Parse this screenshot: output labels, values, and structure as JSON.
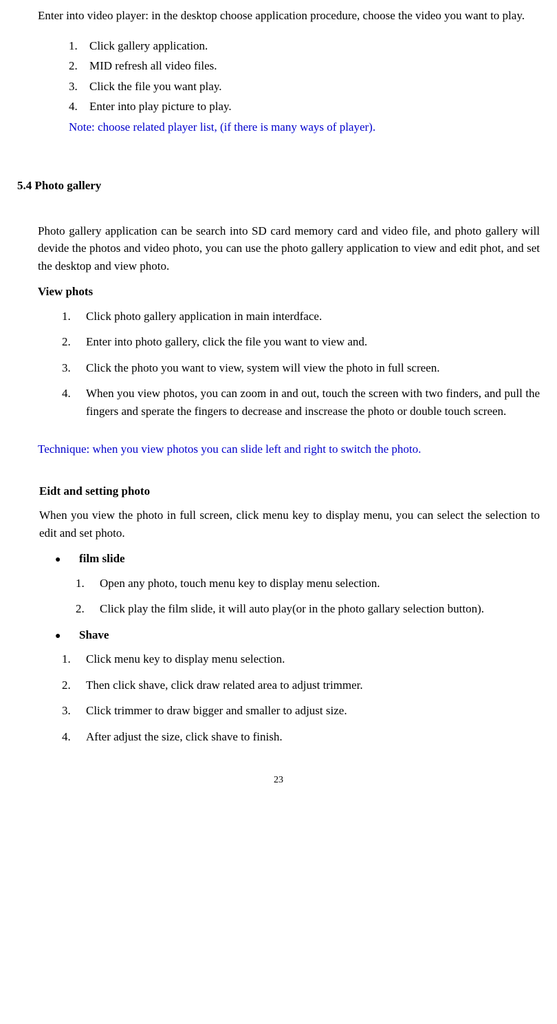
{
  "intro": "Enter into video player: in the desktop choose application procedure, choose the video you want to play.",
  "steps1": {
    "n1": "1.",
    "t1": "Click gallery application.",
    "n2": "2.",
    "t2": "MID refresh all video files.",
    "n3": "3.",
    "t3": "Click the file you want play.",
    "n4": "4.",
    "t4": "Enter into play picture to play."
  },
  "note1": "Note: choose related player list, (if there is many ways of player).",
  "section": "5.4 Photo gallery",
  "galleryIntro": "Photo gallery application can be search into SD card memory card and video file, and photo gallery will devide the photos and video photo, you can use the photo gallery application to view and edit phot, and set the desktop and view photo.",
  "viewHeading": "View phots",
  "view": {
    "n1": "1.",
    "t1": "Click photo gallery application in main interdface.",
    "n2": "2.",
    "t2": "Enter into photo gallery, click the file you want to view and.",
    "n3": "3.",
    "t3": "Click the photo you want to view, system will view the photo in full screen.",
    "n4": "4.",
    "t4": "When you view photos, you can zoom in and out, touch the screen with two finders, and pull the fingers and sperate the fingers to decrease and inscrease the photo or double touch screen."
  },
  "technique": "Technique: when you view photos you can slide left and right to switch the photo.",
  "editHeading": "Eidt and setting photo",
  "editIntro": "When you view the photo in full screen, click menu key to display menu,   you can select the selection to edit and set photo.",
  "bullet1": "film slide",
  "film": {
    "n1": "1.",
    "t1": "Open any photo, touch menu key to display menu selection.",
    "n2": "2.",
    "t2": "Click play the film slide, it will auto play(or in the photo gallary selection button)."
  },
  "bullet2": "Shave",
  "shave": {
    "n1": "1.",
    "t1": "Click menu key to display menu selection.",
    "n2": "2.",
    "t2": "Then click shave, click draw related area to adjust trimmer.",
    "n3": "3.",
    "t3": "Click trimmer to draw bigger and smaller to adjust size.",
    "n4": "4.",
    "t4": "After adjust the size, click shave to finish."
  },
  "pageNum": "23"
}
